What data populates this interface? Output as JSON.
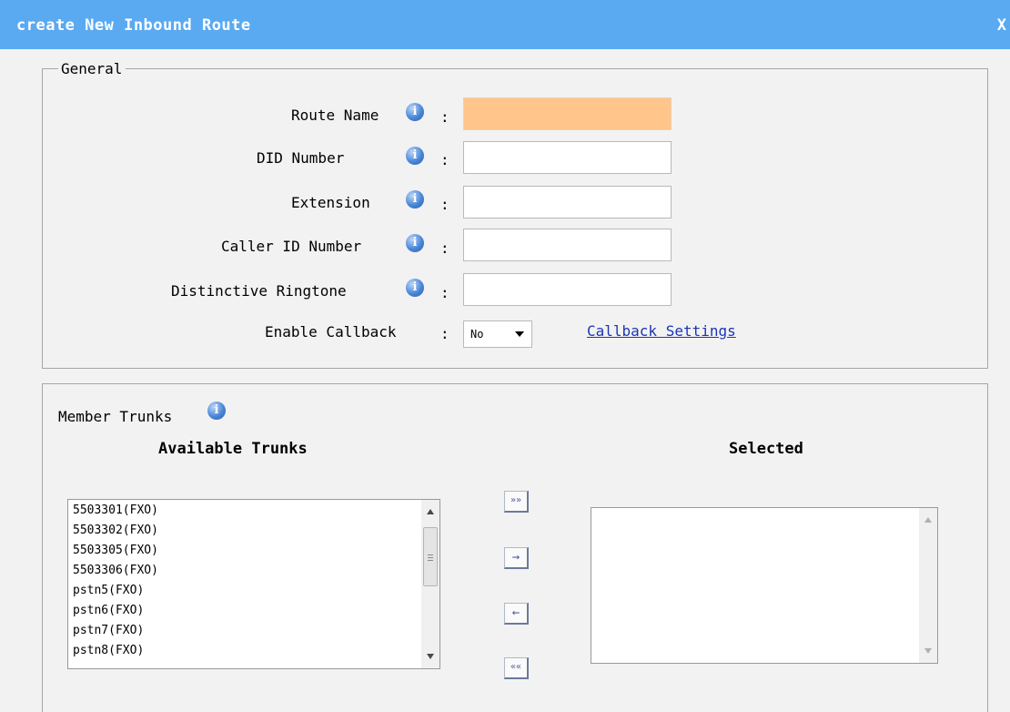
{
  "dialog": {
    "title": "create New Inbound Route",
    "close_label": "X"
  },
  "general": {
    "legend": "General",
    "route_name_label": "Route Name",
    "did_number_label": "DID Number",
    "extension_label": "Extension",
    "caller_id_label": "Caller ID Number",
    "ringtone_label": "Distinctive Ringtone",
    "enable_callback_label": "Enable Callback",
    "colon": ":",
    "info_glyph": "i",
    "route_name_value": "",
    "did_number_value": "",
    "extension_value": "",
    "caller_id_value": "",
    "ringtone_value": "",
    "callback_value": "No",
    "callback_settings_link": "Callback Settings"
  },
  "trunks": {
    "member_label": "Member Trunks",
    "available_heading": "Available Trunks",
    "selected_heading": "Selected",
    "available": [
      "5503301(FXO)",
      "5503302(FXO)",
      "5503305(FXO)",
      "5503306(FXO)",
      "pstn5(FXO)",
      "pstn6(FXO)",
      "pstn7(FXO)",
      "pstn8(FXO)"
    ],
    "selected": [],
    "buttons": {
      "add_all": "»»",
      "add": "→",
      "remove": "←",
      "remove_all": "««"
    }
  },
  "colors": {
    "title_bar": "#5aaaf2",
    "active_field": "#ffc58a",
    "link": "#1a36b8"
  }
}
